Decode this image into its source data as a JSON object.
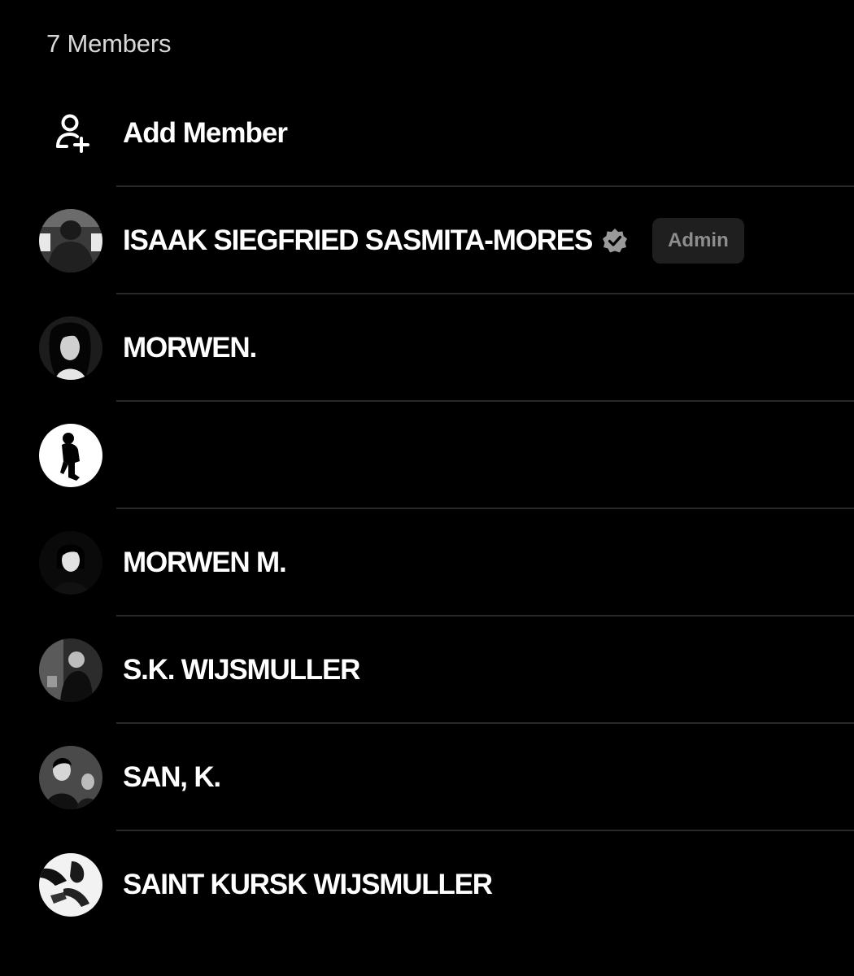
{
  "header": {
    "members_count": "7 Members"
  },
  "add_member": {
    "icon": "add-person-icon",
    "label": "Add Member"
  },
  "members": [
    {
      "name": "ISAAK SIEGFRIED SASMITA-MORES",
      "verified": true,
      "badge": "Admin",
      "avatar": "photo-dark-figure"
    },
    {
      "name": "MORWEN.",
      "verified": false,
      "badge": "",
      "avatar": "photo-long-hair"
    },
    {
      "name": "",
      "verified": false,
      "badge": "",
      "avatar": "silhouette-on-white"
    },
    {
      "name": "MORWEN M.",
      "verified": false,
      "badge": "",
      "avatar": "photo-portrait"
    },
    {
      "name": "S.K. WIJSMULLER",
      "verified": false,
      "badge": "",
      "avatar": "photo-dark-figure"
    },
    {
      "name": "SAN, K.",
      "verified": false,
      "badge": "",
      "avatar": "photo-group"
    },
    {
      "name": "SAINT KURSK WIJSMULLER",
      "verified": false,
      "badge": "",
      "avatar": "photo-light"
    }
  ],
  "colors": {
    "background": "#000000",
    "text": "#ffffff",
    "muted_text": "#d8d8d8",
    "divider": "#2a2a2a",
    "badge_bg": "#1f1f1f",
    "badge_text": "#8d8d8d",
    "verified": "#9a9a9a"
  }
}
